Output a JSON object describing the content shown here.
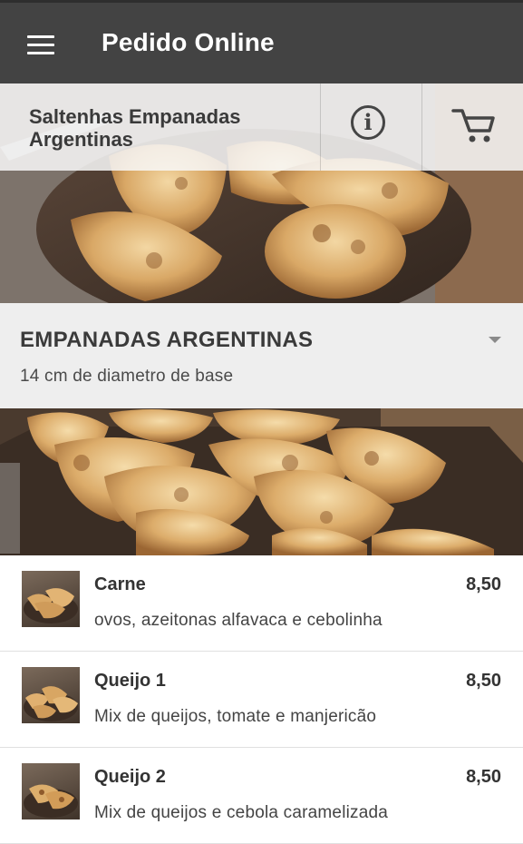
{
  "app_bar": {
    "title": "Pedido Online",
    "menu_icon": "hamburger-menu-icon"
  },
  "restaurant": {
    "name": "Saltenhas Empanadas Argentinas",
    "info_icon": "info-icon",
    "info_glyph": "i",
    "cart_icon": "cart-icon"
  },
  "category": {
    "title": "EMPANADAS ARGENTINAS",
    "subtitle": "14 cm de diametro de base",
    "toggle_icon": "dropdown-arrow-icon"
  },
  "products": [
    {
      "name": "Carne",
      "description": "ovos, azeitonas alfavaca e cebolinha",
      "price": "8,50"
    },
    {
      "name": "Queijo 1",
      "description": "Mix de queijos, tomate e manjericão",
      "price": "8,50"
    },
    {
      "name": "Queijo 2",
      "description": "Mix de queijos e cebola caramelizada",
      "price": "8,50"
    }
  ],
  "colors": {
    "app_bar": "#434343",
    "category_bg": "#eeeeee",
    "text_dark": "#333333"
  }
}
